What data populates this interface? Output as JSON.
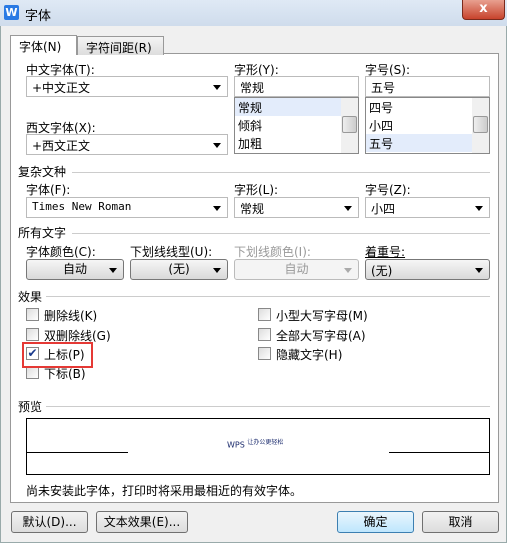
{
  "window": {
    "title": "字体",
    "icon": "wps-writer-icon",
    "close": "x"
  },
  "tabs": [
    {
      "label": "字体(N)",
      "active": true
    },
    {
      "label": "字符间距(R)",
      "active": false
    }
  ],
  "font": {
    "chinese_label": "中文字体(T):",
    "chinese_value": "+中文正文",
    "western_label": "西文字体(X):",
    "western_value": "+西文正文",
    "style_label": "字形(Y):",
    "style_value": "常规",
    "style_options": [
      "常规",
      "倾斜",
      "加粗"
    ],
    "style_selected": "常规",
    "size_label": "字号(S):",
    "size_value": "五号",
    "size_options": [
      "四号",
      "小四",
      "五号"
    ],
    "size_selected": "五号"
  },
  "complex": {
    "section": "复杂文种",
    "font_label": "字体(F):",
    "font_value": "Times New Roman",
    "style_label": "字形(L):",
    "style_value": "常规",
    "size_label": "字号(Z):",
    "size_value": "小四"
  },
  "all_text": {
    "section": "所有文字",
    "color_label": "字体颜色(C):",
    "color_value": "自动",
    "underline_label": "下划线线型(U):",
    "underline_value": "(无)",
    "underline_color_label": "下划线颜色(I):",
    "underline_color_value": "自动",
    "underline_color_disabled": true,
    "emphasis_label": "着重号:",
    "emphasis_value": "(无)"
  },
  "effects": {
    "section": "效果",
    "items": [
      {
        "label": "删除线(K)",
        "checked": false
      },
      {
        "label": "双删除线(G)",
        "checked": false
      },
      {
        "label": "上标(P)",
        "checked": true
      },
      {
        "label": "下标(B)",
        "checked": false
      },
      {
        "label": "小型大写字母(M)",
        "checked": false
      },
      {
        "label": "全部大写字母(A)",
        "checked": false
      },
      {
        "label": "隐藏文字(H)",
        "checked": false
      }
    ],
    "highlight_color": "#e53935"
  },
  "preview": {
    "section": "预览",
    "text_main": "WPS",
    "text_super": "让办公更轻松",
    "note": "尚未安装此字体，打印时将采用最相近的有效字体。"
  },
  "buttons": {
    "default": "默认(D)...",
    "text_effects": "文本效果(E)...",
    "ok": "确定",
    "cancel": "取消"
  }
}
